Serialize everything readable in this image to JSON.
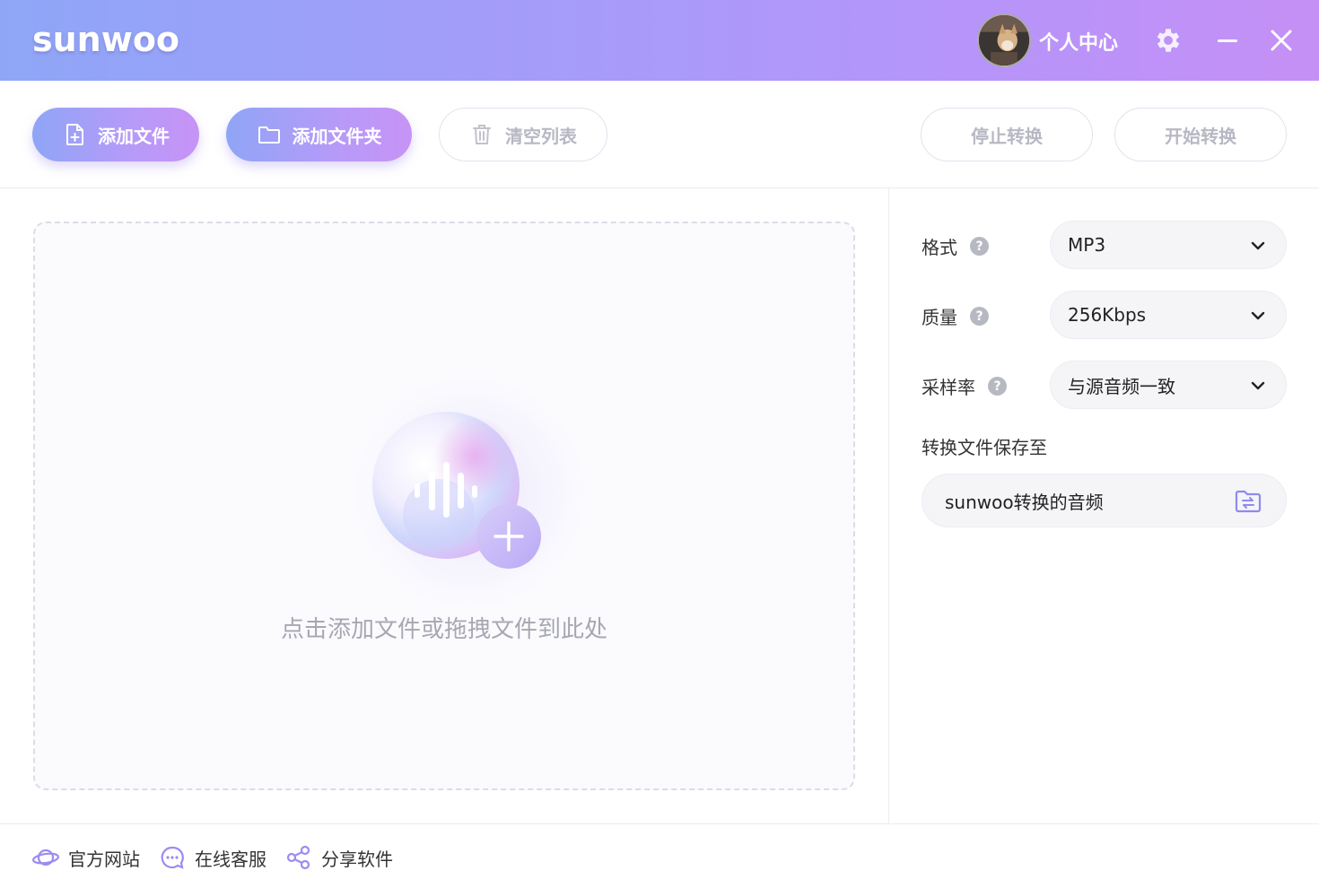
{
  "app": {
    "logo": "sunwoo",
    "user_center": "个人中心",
    "avatar_label": "avatar"
  },
  "toolbar": {
    "add_file": "添加文件",
    "add_folder": "添加文件夹",
    "clear_list": "清空列表",
    "stop_convert": "停止转换",
    "start_convert": "开始转换"
  },
  "dropzone": {
    "hint": "点击添加文件或拖拽文件到此处"
  },
  "settings": {
    "format": {
      "label": "格式",
      "value": "MP3"
    },
    "quality": {
      "label": "质量",
      "value": "256Kbps"
    },
    "sample_rate": {
      "label": "采样率",
      "value": "与源音频一致"
    },
    "save_to": {
      "label": "转换文件保存至",
      "value": "sunwoo转换的音频"
    }
  },
  "footer": {
    "official_site": "官方网站",
    "online_service": "在线客服",
    "share_software": "分享软件"
  },
  "colors": {
    "accent_start": "#8fa5f6",
    "accent_end": "#c693f6",
    "disabled_text": "#b8b8c4",
    "icon_purple": "#9b8cf2"
  }
}
